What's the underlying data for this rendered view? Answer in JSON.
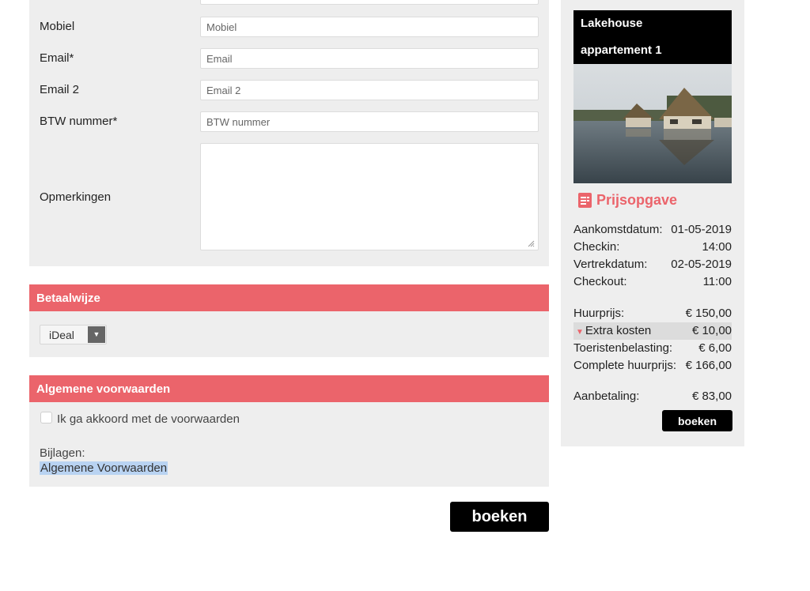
{
  "form": {
    "fields": [
      {
        "label": "Mobiel",
        "placeholder": "Mobiel"
      },
      {
        "label": "Email*",
        "placeholder": "Email"
      },
      {
        "label": "Email 2",
        "placeholder": "Email 2"
      },
      {
        "label": "BTW nummer*",
        "placeholder": "BTW nummer"
      }
    ],
    "remarks_label": "Opmerkingen"
  },
  "payment": {
    "header": "Betaalwijze",
    "selected_method": "iDeal"
  },
  "terms": {
    "header": "Algemene voorwaarden",
    "agree_label": "Ik ga akkoord met de voorwaarden",
    "attachments_label": "Bijlagen:",
    "attachment_link": "Algemene Voorwaarden"
  },
  "book_button_label": "boeken",
  "sidebar": {
    "property_line1": "Lakehouse",
    "property_line2": "appartement 1",
    "quote_heading": "Prijsopgave",
    "dates": [
      {
        "key": "Aankomstdatum:",
        "value": "01-05-2019"
      },
      {
        "key": "Checkin:",
        "value": "14:00"
      },
      {
        "key": "Vertrekdatum:",
        "value": "02-05-2019"
      },
      {
        "key": "Checkout:",
        "value": "11:00"
      }
    ],
    "prices": [
      {
        "key": "Huurprijs:",
        "value": "€ 150,00"
      },
      {
        "key": "Extra kosten",
        "value": "€ 10,00"
      },
      {
        "key": "Toeristenbelasting:",
        "value": "€ 6,00"
      },
      {
        "key": "Complete huurprijs:",
        "value": "€ 166,00"
      }
    ],
    "deposit": {
      "key": "Aanbetaling:",
      "value": "€ 83,00"
    },
    "book_label": "boeken"
  },
  "colors": {
    "accent": "#eb646b",
    "panel": "#eeeeee",
    "button": "#000000"
  }
}
